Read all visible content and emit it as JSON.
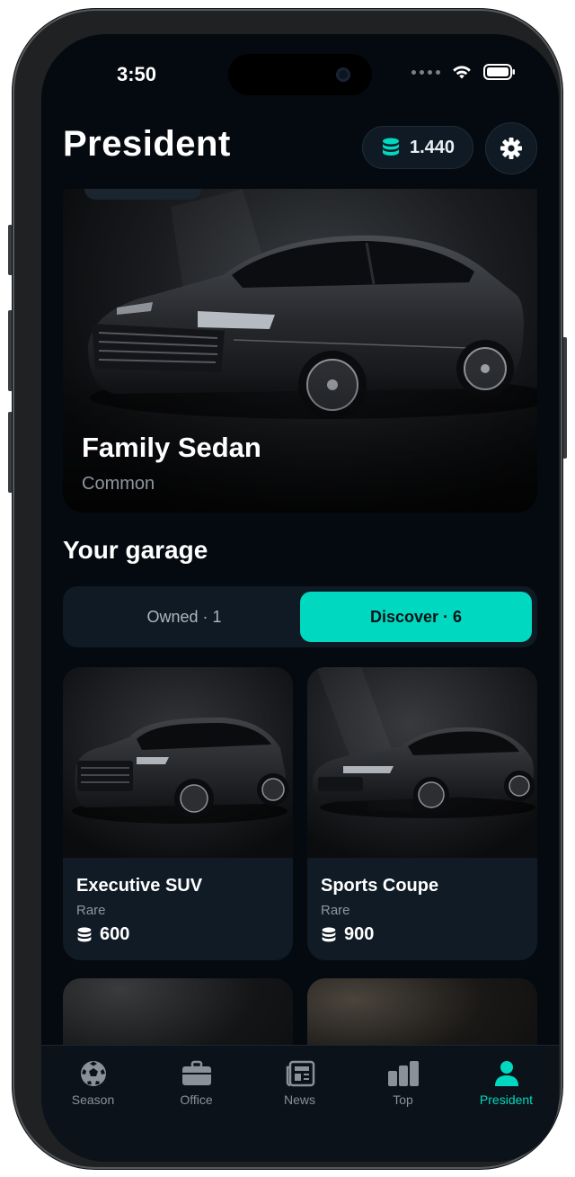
{
  "status_bar": {
    "time": "3:50"
  },
  "header": {
    "title": "President",
    "coin_balance": "1.440"
  },
  "featured_car": {
    "name": "Family Sedan",
    "rarity": "Common"
  },
  "garage": {
    "title": "Your garage",
    "segments": [
      {
        "label": "Owned · 1",
        "active": false
      },
      {
        "label": "Discover · 6",
        "active": true
      }
    ],
    "cards": [
      {
        "name": "Executive SUV",
        "rarity": "Rare",
        "price": "600"
      },
      {
        "name": "Sports Coupe",
        "rarity": "Rare",
        "price": "900"
      }
    ]
  },
  "tab_bar": {
    "tabs": [
      {
        "label": "Season",
        "icon": "soccer-ball-icon"
      },
      {
        "label": "Office",
        "icon": "briefcase-icon"
      },
      {
        "label": "News",
        "icon": "newspaper-icon"
      },
      {
        "label": "Top",
        "icon": "bar-chart-icon"
      },
      {
        "label": "President",
        "icon": "person-icon",
        "active": true
      }
    ]
  },
  "colors": {
    "accent": "#00d9c0",
    "background": "#050a10",
    "card": "#101b25"
  }
}
